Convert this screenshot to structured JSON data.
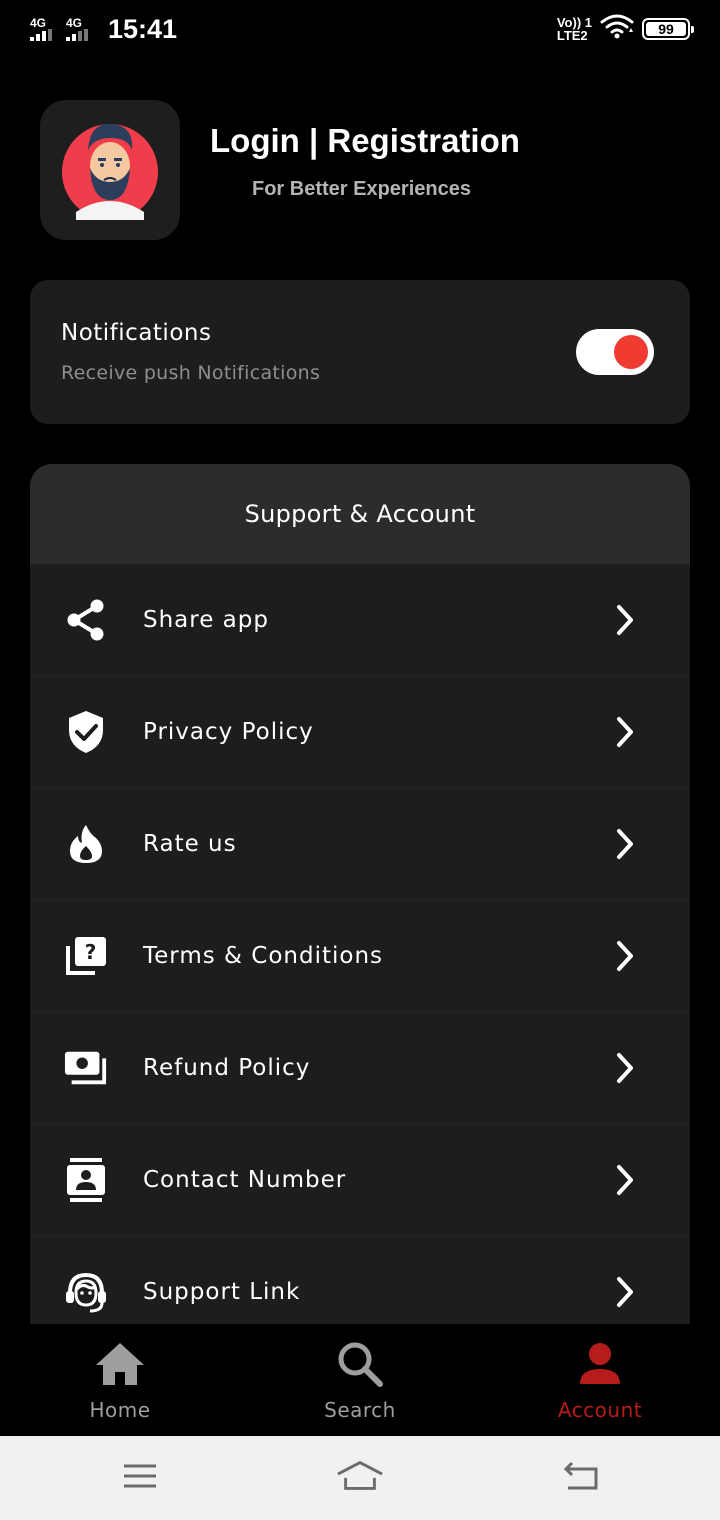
{
  "status_bar": {
    "network1": "4G",
    "network2": "4G",
    "time": "15:41",
    "volte_line1": "Vo)) 1",
    "volte_line2": "LTE2",
    "battery": "99"
  },
  "profile": {
    "title": "Login | Registration",
    "subtitle": "For Better Experiences"
  },
  "notifications": {
    "title": "Notifications",
    "subtitle": "Receive push Notifications",
    "enabled": true
  },
  "support": {
    "header": "Support & Account",
    "items": [
      {
        "label": "Share app",
        "icon": "share-icon"
      },
      {
        "label": "Privacy Policy",
        "icon": "shield-check-icon"
      },
      {
        "label": "Rate us",
        "icon": "flame-icon"
      },
      {
        "label": "Terms & Conditions",
        "icon": "question-cards-icon"
      },
      {
        "label": "Refund Policy",
        "icon": "money-icon"
      },
      {
        "label": "Contact Number",
        "icon": "contact-card-icon"
      },
      {
        "label": "Support Link",
        "icon": "support-agent-icon"
      }
    ]
  },
  "bottom_nav": {
    "items": [
      {
        "label": "Home",
        "icon": "home-icon",
        "active": false
      },
      {
        "label": "Search",
        "icon": "search-icon",
        "active": false
      },
      {
        "label": "Account",
        "icon": "account-icon",
        "active": true
      }
    ]
  },
  "colors": {
    "background": "#000000",
    "card": "#1d1d1d",
    "card_header": "#2c2c2c",
    "accent": "#ef3b32",
    "nav_active": "#b71c1c",
    "nav_inactive": "#9e9e9e"
  }
}
